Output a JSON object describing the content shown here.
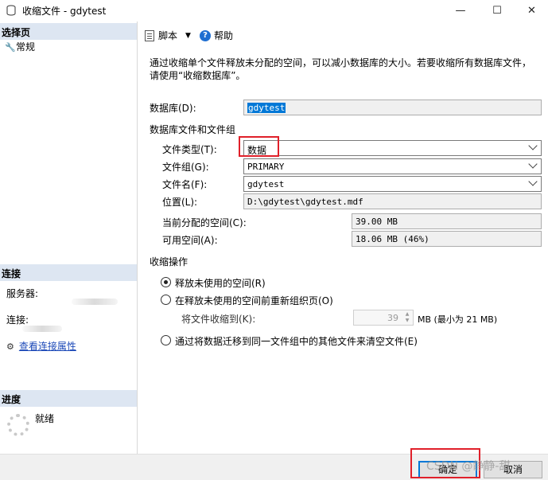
{
  "window": {
    "title": "收缩文件 - gdytest",
    "minimize_glyph": "—",
    "maximize_glyph": "☐",
    "close_glyph": "✕"
  },
  "left": {
    "select_page_header": "选择页",
    "pages": [
      {
        "label": "常规",
        "icon": "wrench-icon"
      }
    ],
    "connection_header": "连接",
    "server_label": "服务器:",
    "connection_label": "连接:",
    "view_connection_props": "查看连接属性",
    "progress_header": "进度",
    "progress_status": "就绪"
  },
  "toolbar": {
    "script_label": "脚本",
    "help_label": "帮助"
  },
  "main": {
    "description": "通过收缩单个文件释放未分配的空间，可以减小数据库的大小。若要收缩所有数据库文件，请使用“收缩数据库”。",
    "database_label": "数据库(D):",
    "database_value": "gdytest",
    "files_group_title": "数据库文件和文件组",
    "file_type_label": "文件类型(T):",
    "file_type_value": "数据",
    "filegroup_label": "文件组(G):",
    "filegroup_value": "PRIMARY",
    "filename_label": "文件名(F):",
    "filename_value": "gdytest",
    "location_label": "位置(L):",
    "location_value": "D:\\gdytest\\gdytest.mdf",
    "allocated_label": "当前分配的空间(C):",
    "allocated_value": "39.00 MB",
    "available_label": "可用空间(A):",
    "available_value": "18.06 MB (46%)",
    "shrink_title": "收缩操作",
    "option_release": "释放未使用的空间(R)",
    "option_reorganize": "在释放未使用的空间前重新组织页(O)",
    "shrink_to_label": "将文件收缩到(K):",
    "shrink_to_value": "39",
    "shrink_to_unit": "MB (最小为 21 MB)",
    "option_empty": "通过将数据迁移到同一文件组中的其他文件来清空文件(E)",
    "selected_option": "release"
  },
  "buttons": {
    "ok": "确定",
    "cancel": "取消"
  },
  "watermark": "CSDN @静静-甜",
  "colors": {
    "section_header_bg": "#dde6f2",
    "link": "#1c49b8",
    "highlight_box": "#e0202a",
    "selection": "#0078d7"
  }
}
